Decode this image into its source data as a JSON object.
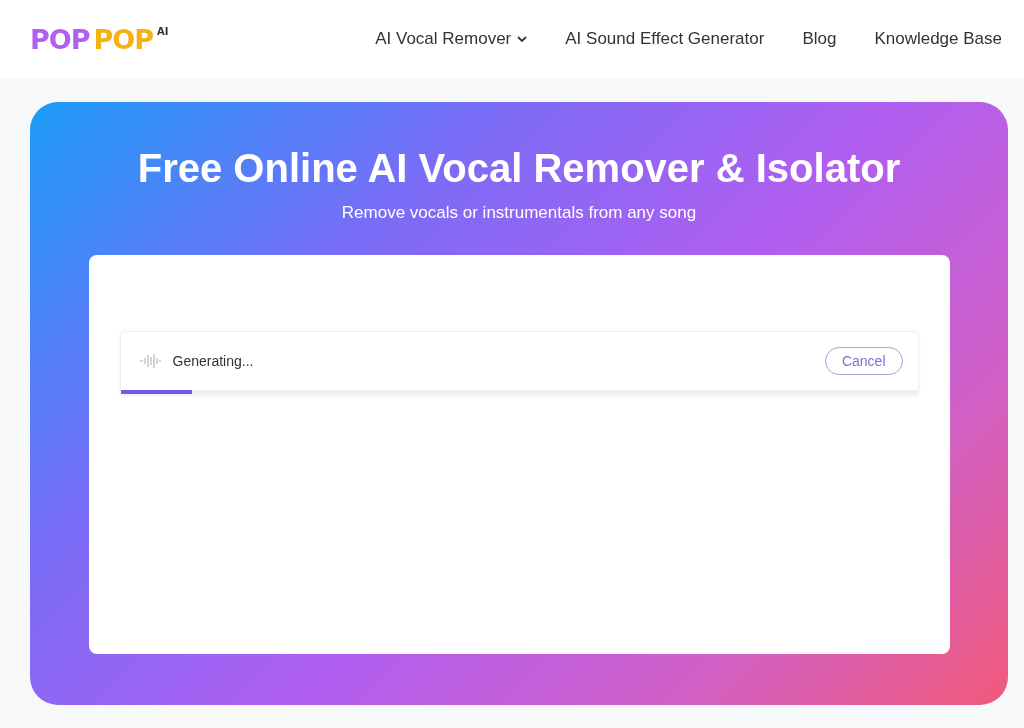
{
  "header": {
    "logo": {
      "word_1": "POP",
      "word_2": "POP",
      "suffix": "AI"
    },
    "nav": [
      {
        "label": "AI Vocal Remover",
        "has_dropdown": true
      },
      {
        "label": "AI Sound Effect Generator",
        "has_dropdown": false
      },
      {
        "label": "Blog",
        "has_dropdown": false
      },
      {
        "label": "Knowledge Base",
        "has_dropdown": false
      }
    ]
  },
  "hero": {
    "title": "Free Online AI Vocal Remover & Isolator",
    "subtitle": "Remove vocals or instrumentals from any song"
  },
  "task": {
    "status": "Generating...",
    "cancel": "Cancel",
    "level": 0.09
  }
}
